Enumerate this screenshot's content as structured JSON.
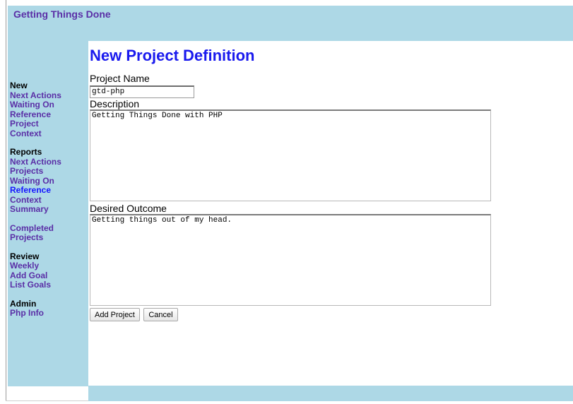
{
  "app": {
    "title": "Getting Things Done"
  },
  "nav": [
    {
      "heading": "New",
      "items": [
        {
          "label": "Next Actions"
        },
        {
          "label": "Waiting On"
        },
        {
          "label": "Reference"
        },
        {
          "label": "Project"
        },
        {
          "label": "Context"
        }
      ]
    },
    {
      "heading": "Reports",
      "items": [
        {
          "label": "Next Actions"
        },
        {
          "label": "Projects"
        },
        {
          "label": "Waiting On"
        },
        {
          "label": "Reference",
          "current": true
        },
        {
          "label": "Context"
        },
        {
          "label": "Summary"
        }
      ]
    },
    {
      "heading": "",
      "items": [
        {
          "label": "Completed"
        },
        {
          "label": "Projects"
        }
      ]
    },
    {
      "heading": "Review",
      "items": [
        {
          "label": "Weekly"
        },
        {
          "label": "Add Goal"
        },
        {
          "label": "List Goals"
        }
      ]
    },
    {
      "heading": "Admin",
      "items": [
        {
          "label": "Php Info"
        }
      ]
    }
  ],
  "form": {
    "title": "New Project Definition",
    "project_name_label": "Project Name",
    "project_name_value": "gtd-php",
    "description_label": "Description",
    "description_value": "Getting Things Done with PHP",
    "outcome_label": "Desired Outcome",
    "outcome_value": "Getting things out of my head.",
    "submit_label": "Add Project",
    "cancel_label": "Cancel"
  },
  "colors": {
    "panel": "#add8e6",
    "link": "#5a2ea6",
    "title": "#1a1aee",
    "current_link": "#1515ff"
  }
}
